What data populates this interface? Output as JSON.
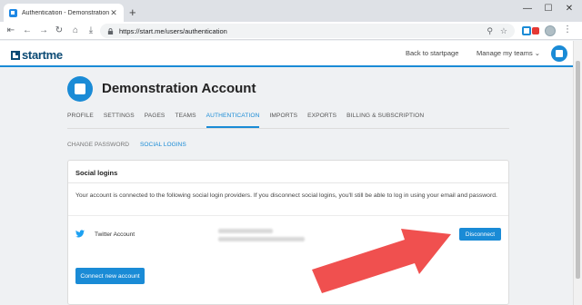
{
  "browser": {
    "tab_title": "Authentication - Demonstration...",
    "tab_close": "✕",
    "new_tab": "+",
    "window_controls": [
      "—",
      "☐",
      "✕"
    ],
    "url": "https://start.me/users/authentication",
    "nav_icons": [
      "back-icon",
      "forward-icon",
      "reload-icon",
      "home-icon",
      "download-icon"
    ]
  },
  "site": {
    "logo_text": "startme",
    "back_link": "Back to startpage",
    "manage_teams": "Manage my teams ⌄"
  },
  "account": {
    "name": "Demonstration Account"
  },
  "main_nav": [
    {
      "label": "PROFILE",
      "active": false
    },
    {
      "label": "SETTINGS",
      "active": false
    },
    {
      "label": "PAGES",
      "active": false
    },
    {
      "label": "TEAMS",
      "active": false
    },
    {
      "label": "AUTHENTICATION",
      "active": true
    },
    {
      "label": "IMPORTS",
      "active": false
    },
    {
      "label": "EXPORTS",
      "active": false
    },
    {
      "label": "BILLING & SUBSCRIPTION",
      "active": false
    }
  ],
  "sub_nav": [
    {
      "label": "CHANGE PASSWORD",
      "active": false
    },
    {
      "label": "SOCIAL LOGINS",
      "active": true
    }
  ],
  "card": {
    "title": "Social logins",
    "description": "Your account is connected to the following social login providers. If you disconnect social logins, you'll still be able to log in using your email and password.",
    "provider": "Twitter Account",
    "disconnect_label": "Disconnect",
    "connect_new_label": "Connect new account"
  },
  "colors": {
    "accent": "#1a8bd6",
    "arrow": "#f0504f",
    "twitter": "#1da1f2"
  }
}
